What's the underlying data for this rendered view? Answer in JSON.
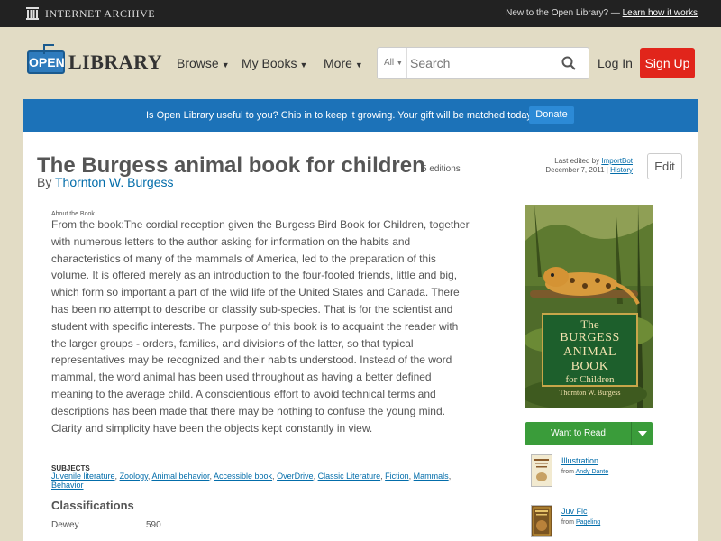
{
  "ia_bar": {
    "logo_text": "Internet Archive",
    "tagline": "New to the Open Library? —",
    "tagline_link": "Learn how it works"
  },
  "header": {
    "logo_open": "OPEN",
    "logo_library": "LIBRARY",
    "nav": {
      "browse": "Browse",
      "my_books": "My Books",
      "more": "More"
    },
    "search": {
      "scope": "All",
      "placeholder": "Search"
    },
    "login": "Log In",
    "signup": "Sign Up"
  },
  "banner": {
    "text": "Is Open Library useful to you? Chip in to keep it growing. Your gift will be matched today!",
    "donate": "Donate"
  },
  "book": {
    "title": "The Burgess animal book for children",
    "editions": "5 editions",
    "by": "By",
    "author": "Thornton W. Burgess",
    "last_edited_label": "Last edited by",
    "last_edited_by": "ImportBot",
    "last_edited_date": "December 7, 2011",
    "history": "History",
    "edit": "Edit",
    "about_label": "About the Book",
    "description": "From the book:The cordial reception given the Burgess Bird Book for Children, together with numerous letters to the author asking for information on the habits and characteristics of many of the mammals of America, led to the preparation of this volume. It is offered merely as an introduction to the four-footed friends, little and big, which form so important a part of the wild life of the United States and Canada. There has been no attempt to describe or classify sub-species. That is for the scientist and student with specific interests. The purpose of this book is to acquaint the reader with the larger groups - orders, families, and divisions of the latter, so that typical representatives may be recognized and their habits understood. Instead of the word mammal, the word animal has been used throughout as having a better defined meaning to the average child. A conscientious effort to avoid technical terms and descriptions has been made that there may be nothing to confuse the young mind. Clarity and simplicity have been the objects kept constantly in view.",
    "subjects_label": "SUBJECTS",
    "subjects": [
      "Juvenile literature",
      "Zoology",
      "Animal behavior",
      "Accessible book",
      "OverDrive",
      "Classic Literature",
      "Fiction",
      "Mammals",
      "Behavior"
    ],
    "classifications_title": "Classifications",
    "classifications": [
      {
        "key": "Dewey",
        "value": "590"
      }
    ]
  },
  "cover": {
    "line1": "The",
    "line2": "BURGESS",
    "line3": "ANIMAL BOOK",
    "line4": "for Children",
    "line5": "Thornton W. Burgess"
  },
  "sidebar": {
    "want_to_read": "Want to Read",
    "editions": [
      {
        "title": "Illustration",
        "from": "from",
        "publisher": "Andy Dante"
      },
      {
        "title": "Juv Fic",
        "from": "from",
        "publisher": "Pageling"
      }
    ]
  },
  "colors": {
    "ia_bar": "#222222",
    "page_bg": "#e2dcc5",
    "banner": "#1c72b8",
    "signup": "#e1251b",
    "want_to_read": "#3a9c3a",
    "link": "#036daa"
  }
}
